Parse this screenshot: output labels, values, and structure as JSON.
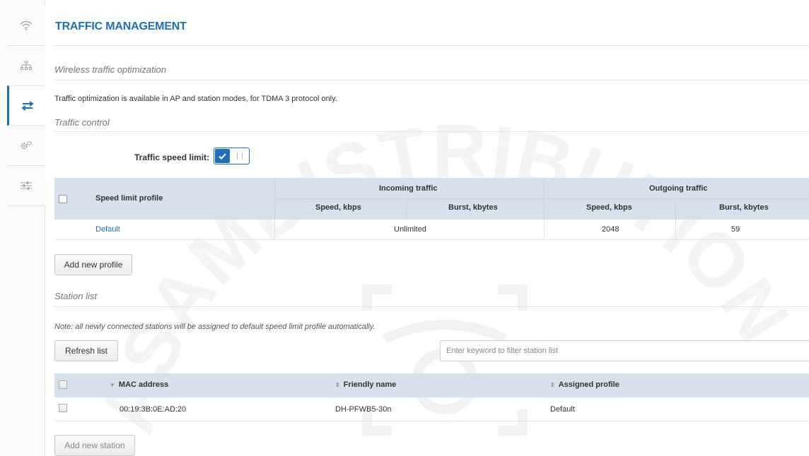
{
  "sidebar": {
    "items": [
      {
        "icon": "wifi-icon",
        "active": false
      },
      {
        "icon": "network-tree-icon",
        "active": false
      },
      {
        "icon": "traffic-arrows-icon",
        "active": true
      },
      {
        "icon": "gears-icon",
        "active": false
      },
      {
        "icon": "sliders-icon",
        "active": false
      }
    ]
  },
  "page": {
    "title": "TRAFFIC MANAGEMENT"
  },
  "wireless": {
    "section_title": "Wireless traffic optimization",
    "info": "Traffic optimization is available in AP and station modes, for TDMA 3 protocol only."
  },
  "traffic_control": {
    "section_title": "Traffic control",
    "toggle_label": "Traffic speed limit:",
    "toggle_on": true
  },
  "profiles_table": {
    "col_profile": "Speed limit profile",
    "group_incoming": "Incoming traffic",
    "group_outgoing": "Outgoing traffic",
    "in_speed": "Speed, kbps",
    "in_burst": "Burst, kbytes",
    "out_speed": "Speed, kbps",
    "out_burst": "Burst, kbytes",
    "rows": [
      {
        "profile": "Default",
        "incoming": "Unlimited",
        "out_speed": "2048",
        "out_burst": "59"
      }
    ]
  },
  "add_profile_label": "Add new profile",
  "station_list": {
    "section_title": "Station list",
    "note": "Note: all newly connected stations will be assigned to default speed limit profile automatically.",
    "refresh_label": "Refresh list",
    "filter_placeholder": "Enter keyword to filter station list",
    "col_mac": "MAC address",
    "col_friendly": "Friendly name",
    "col_profile": "Assigned profile",
    "rows": [
      {
        "mac": "00:19:3B:0E:AD:20",
        "friendly": "DH-PFWB5-30n",
        "profile": "Default"
      }
    ],
    "add_station_label": "Add new station"
  },
  "colors": {
    "accent": "#1f6fb5",
    "table_header": "#d7e1ec"
  },
  "watermark_text": "ASAMDISTRIBUTION"
}
